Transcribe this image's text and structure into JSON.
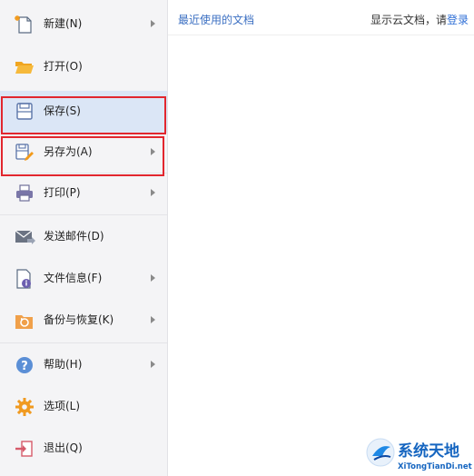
{
  "menu": {
    "items": [
      {
        "label": "新建(N)",
        "icon": "new-document-icon",
        "has_submenu": true
      },
      {
        "label": "打开(O)",
        "icon": "folder-open-icon",
        "has_submenu": false
      },
      {
        "label": "保存(S)",
        "icon": "save-icon",
        "has_submenu": false,
        "selected": true
      },
      {
        "label": "另存为(A)",
        "icon": "save-as-icon",
        "has_submenu": true
      },
      {
        "label": "打印(P)",
        "icon": "printer-icon",
        "has_submenu": true
      },
      {
        "label": "发送邮件(D)",
        "icon": "mail-icon",
        "has_submenu": false
      },
      {
        "label": "文件信息(F)",
        "icon": "file-info-icon",
        "has_submenu": true
      },
      {
        "label": "备份与恢复(K)",
        "icon": "backup-restore-icon",
        "has_submenu": true
      },
      {
        "label": "帮助(H)",
        "icon": "help-icon",
        "has_submenu": true
      },
      {
        "label": "选项(L)",
        "icon": "gear-icon",
        "has_submenu": false
      },
      {
        "label": "退出(Q)",
        "icon": "exit-icon",
        "has_submenu": false
      }
    ]
  },
  "main": {
    "recent_title": "最近使用的文档",
    "cloud_hint_prefix": "显示云文档，请",
    "login_link": "登录"
  },
  "watermark": {
    "text": "系统天地",
    "url_text": "XiTongTianDi.net"
  },
  "colors": {
    "menu_bg": "#f4f4f6",
    "selected_bg": "#dbe6f6",
    "highlight_border": "#e2262e",
    "title_blue": "#3b6fc2",
    "link_blue": "#2f6fd6",
    "watermark_blue": "#1565c0"
  }
}
